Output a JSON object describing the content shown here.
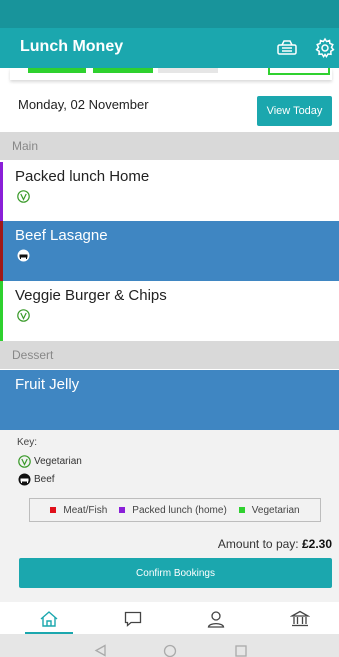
{
  "app": {
    "title": "Lunch Money"
  },
  "colors": {
    "brand": "#1ba7ae",
    "selected": "#3f86c2",
    "meat": "#e0101a",
    "packed_lunch": "#8a1fd8",
    "vegetarian": "#2fd12f"
  },
  "header_icons": [
    "basket-icon",
    "gear-icon"
  ],
  "date_bar": {
    "date": "Monday, 02 November",
    "view_today_label": "View Today"
  },
  "sections": {
    "main": {
      "label": "Main",
      "items": [
        {
          "name": "Packed lunch Home",
          "icon": "vegetarian-icon",
          "category": "packed_lunch",
          "selected": false
        },
        {
          "name": "Beef Lasagne",
          "icon": "beef-icon",
          "category": "meat",
          "selected": true
        },
        {
          "name": "Veggie Burger & Chips",
          "icon": "vegetarian-icon",
          "category": "vegetarian",
          "selected": false
        }
      ]
    },
    "dessert": {
      "label": "Dessert",
      "items": [
        {
          "name": "Fruit Jelly",
          "selected": true
        }
      ]
    }
  },
  "key": {
    "title": "Key:",
    "vegetarian": "Vegetarian",
    "beef": "Beef"
  },
  "legend": {
    "meat": "Meat/Fish",
    "packed": "Packed lunch (home)",
    "veg": "Vegetarian"
  },
  "amount": {
    "label": "Amount to pay:",
    "value": "£2.30"
  },
  "confirm_label": "Confirm Bookings",
  "bottom_nav": [
    "home-icon",
    "chat-icon",
    "profile-icon",
    "bank-icon"
  ],
  "active_nav": "home"
}
